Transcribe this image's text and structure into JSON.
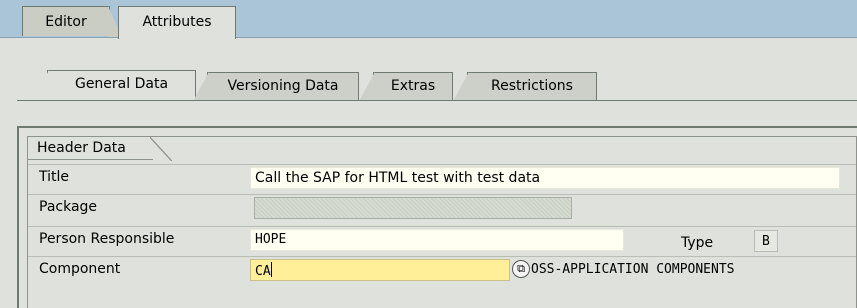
{
  "top_tabs": [
    {
      "label": "Editor",
      "active": false
    },
    {
      "label": "Attributes",
      "active": true
    }
  ],
  "sub_tabs": [
    {
      "label": "General Data",
      "active": true
    },
    {
      "label": "Versioning Data",
      "active": false
    },
    {
      "label": "Extras",
      "active": false
    },
    {
      "label": "Restrictions",
      "active": false
    }
  ],
  "group": {
    "title": "Header Data",
    "fields": {
      "title": {
        "label": "Title",
        "value": "Call the SAP for HTML test with test data"
      },
      "package": {
        "label": "Package",
        "value": ""
      },
      "person": {
        "label": "Person Responsible",
        "value": "HOPE"
      },
      "type": {
        "label": "Type",
        "value": "B"
      },
      "component": {
        "label": "Component",
        "value": "CA",
        "description": "OSS-APPLICATION COMPONENTS"
      }
    }
  },
  "colors": {
    "top_strip": "#a9c5d7",
    "background": "#dfe1dc",
    "active_field": "#ffef99",
    "input_field": "#fffff2"
  },
  "icons": {
    "value_help": "value-help-icon"
  }
}
